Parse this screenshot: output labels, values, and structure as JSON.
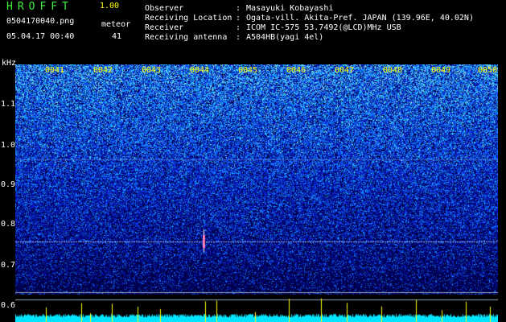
{
  "header": {
    "app_title": "HROFFT",
    "version": "1.00",
    "filename": "0504170040.png",
    "meteor_label": "meteor",
    "datetime": "05.04.17 00:40",
    "meteor_count": "41"
  },
  "info": {
    "observer_label": "Observer",
    "observer": "Masayuki Kobayashi",
    "location_label": "Receiving Location",
    "location": "Ogata-vill. Akita-Pref. JAPAN (139.96E, 40.02N)",
    "receiver_label": "Receiver",
    "receiver": "ICOM IC-575 53.7492(@LCD)MHz USB",
    "antenna_label": "Receiving antenna",
    "antenna": "A504HB(yagi 4el)",
    "sep": ":"
  },
  "axis": {
    "unit": "kHz",
    "y_ticks": [
      "1.1",
      "1.0",
      "0.9",
      "0.8",
      "0.7",
      "0.6"
    ],
    "time_marks": [
      "0041",
      "0042",
      "0043",
      "0044",
      "0045",
      "0046",
      "0047",
      "0048",
      "0049",
      "0050"
    ]
  },
  "colors": {
    "background": "#000000",
    "title_green": "#3cf03c",
    "accent_yellow": "#ffff00",
    "signal_blue": "#1a3cff",
    "meteor_cyan": "#00e5ff"
  }
}
